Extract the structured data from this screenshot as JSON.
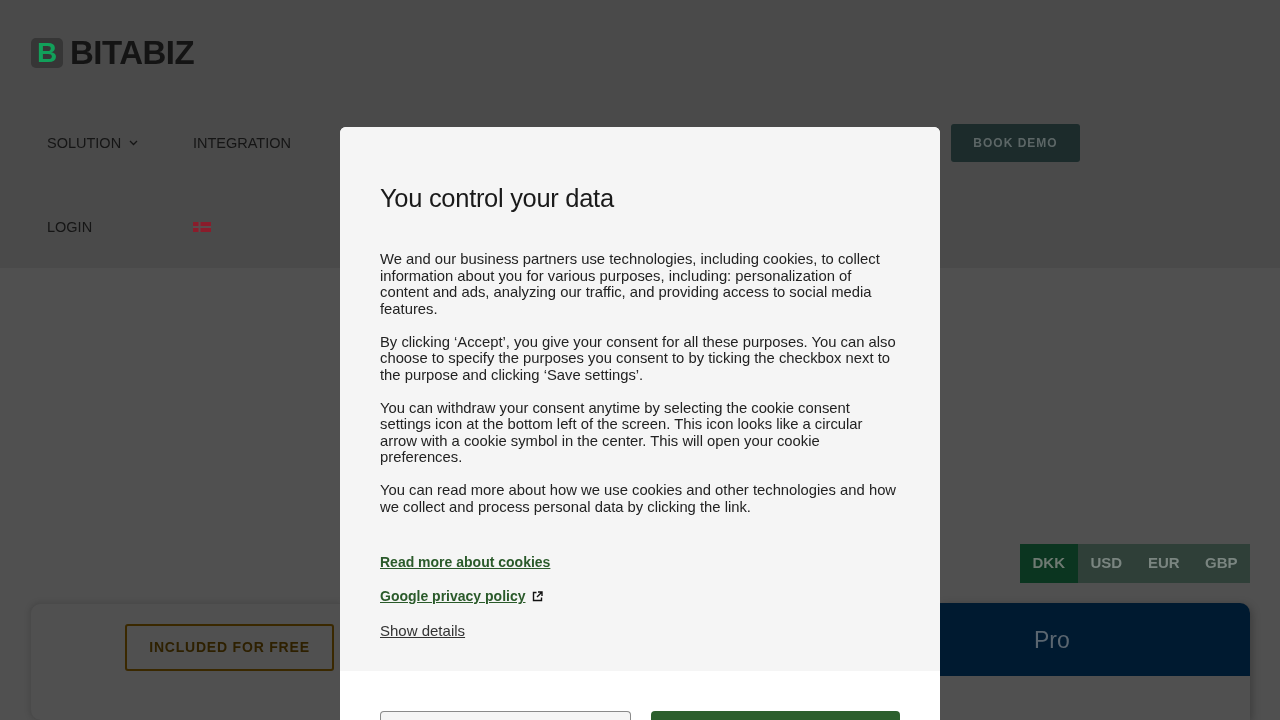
{
  "header": {
    "logo": {
      "mark": "B",
      "name": "BITABIZ"
    },
    "nav": [
      {
        "label": "SOLUTION",
        "kind": "dropdown"
      },
      {
        "label": "INTEGRATION",
        "kind": "link"
      }
    ],
    "cta_button": "BOOK DEMO",
    "nav_secondary": [
      {
        "label": "LOGIN",
        "kind": "link"
      }
    ]
  },
  "currency_tabs": [
    {
      "label": "DKK",
      "selected": true
    },
    {
      "label": "USD",
      "selected": false
    },
    {
      "label": "EUR",
      "selected": false
    },
    {
      "label": "GBP",
      "selected": false
    }
  ],
  "plans": [
    {
      "kind": "free",
      "badge": "INCLUDED FOR FREE"
    },
    {
      "kind": "pro",
      "title": "Pro"
    }
  ],
  "consent_dialog": {
    "title": "You control your data",
    "paragraphs": [
      "We and our business partners use technologies, including cookies, to collect information about you for various purposes, including: personalization of content and ads, analyzing our traffic, and providing access to social media features.",
      "By clicking ‘Accept’, you give your consent for all these purposes. You can also choose to specify the purposes you consent to by ticking the checkbox next to the purpose and clicking ‘Save settings’.",
      "You can withdraw your consent anytime by selecting the cookie consent settings icon at the bottom left of the screen. This icon looks like a circular arrow with a cookie symbol in the center. This will open your cookie preferences.",
      "You can read more about how we use cookies and other technologies and how we collect and process personal data by clicking the link."
    ],
    "links": [
      {
        "label": "Read more about cookies",
        "kind": "internal"
      },
      {
        "label": "Google privacy policy",
        "kind": "external"
      },
      {
        "label": "Show details",
        "kind": "toggle"
      }
    ],
    "buttons": [
      {
        "kind": "secondary"
      },
      {
        "kind": "primary"
      }
    ]
  }
}
